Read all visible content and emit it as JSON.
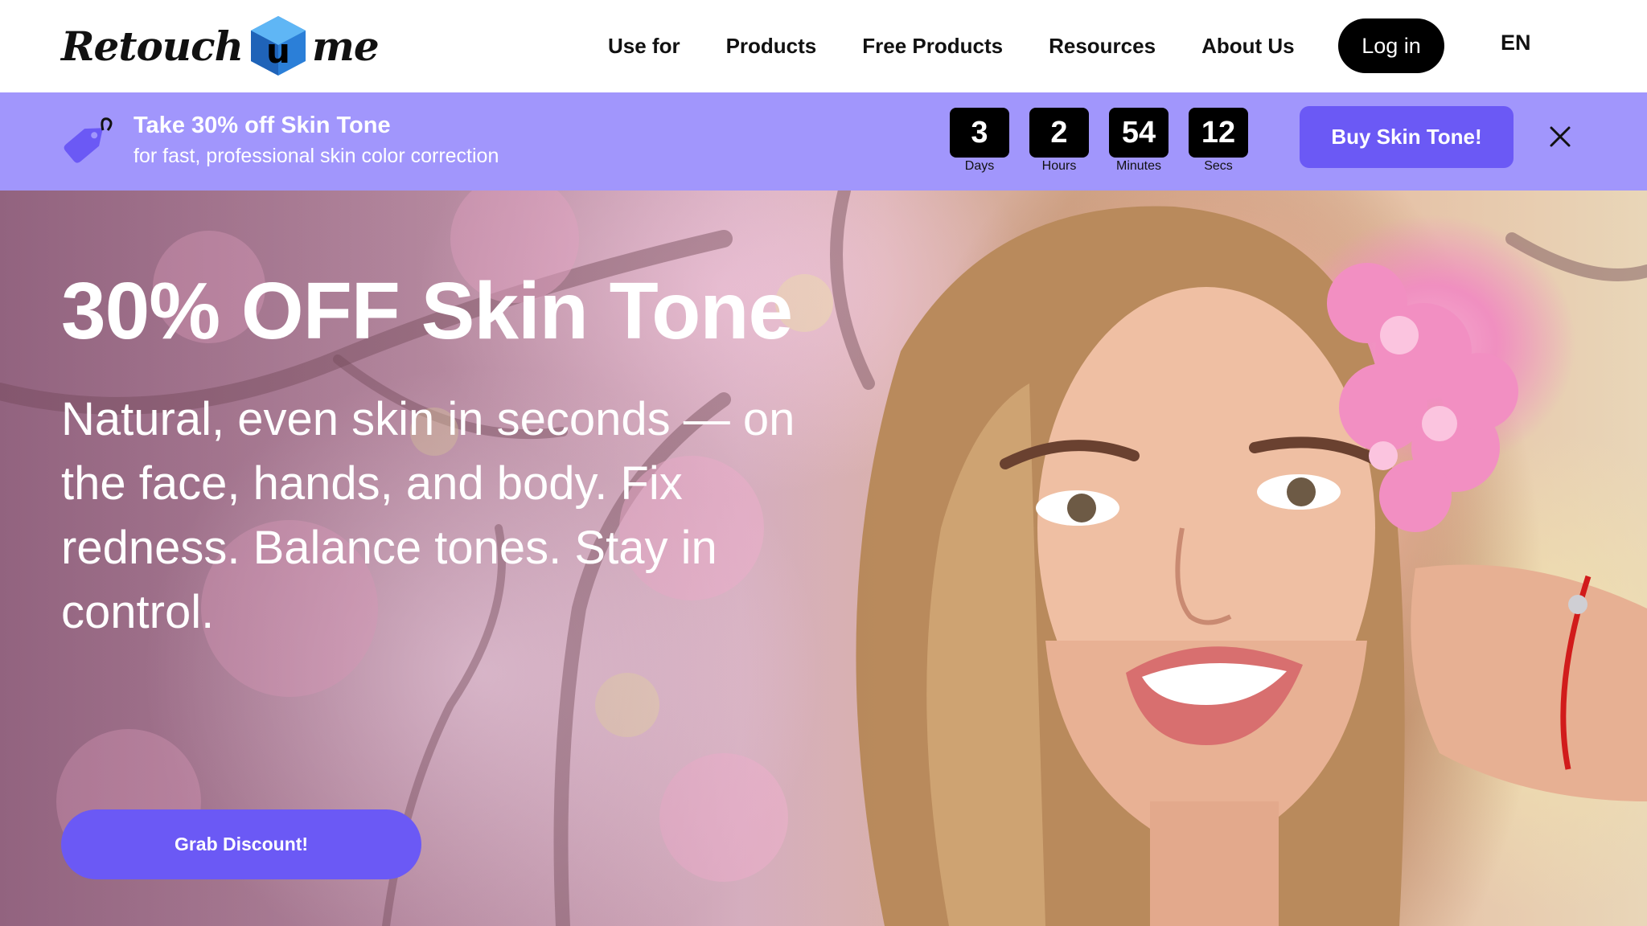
{
  "header": {
    "logo": {
      "left_text": "Retouch",
      "right_text": "me",
      "cube_letter": "u"
    },
    "nav": [
      "Use for",
      "Products",
      "Free Products",
      "Resources",
      "About Us"
    ],
    "login_label": "Log in",
    "language": "EN"
  },
  "promo": {
    "icon": "price-tag-icon",
    "title": "Take 30% off Skin Tone",
    "subtitle": "for fast, professional skin color correction",
    "countdown": [
      {
        "value": "3",
        "label": "Days"
      },
      {
        "value": "2",
        "label": "Hours"
      },
      {
        "value": "54",
        "label": "Minutes"
      },
      {
        "value": "12",
        "label": "Secs"
      }
    ],
    "buy_label": "Buy Skin Tone!",
    "close_icon": "close-icon"
  },
  "hero": {
    "title": "30% OFF Skin Tone",
    "subtitle": "Natural, even skin in seconds —  on the face, hands, and body. Fix redness. Balance tones. Stay in control.",
    "cta_label": "Grab Discount!"
  },
  "colors": {
    "promo_bg": "#a196fc",
    "accent": "#6b59f5",
    "dark": "#000000"
  }
}
